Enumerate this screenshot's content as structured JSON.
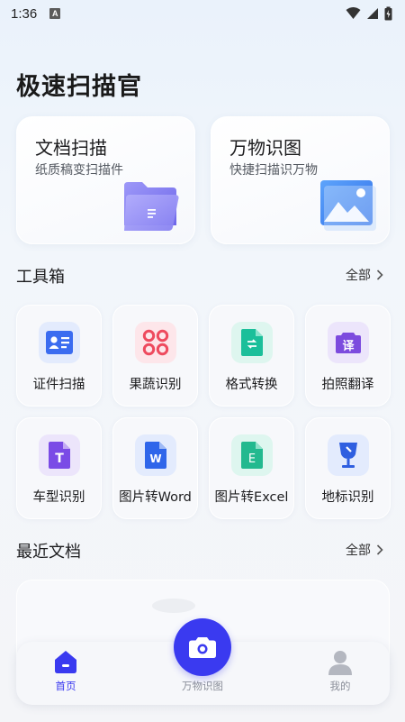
{
  "status_bar": {
    "time": "1:36",
    "notif_letter": "A"
  },
  "app_title": "极速扫描官",
  "cards": [
    {
      "title": "文档扫描",
      "subtitle": "纸质稿变扫描件",
      "icon": "folder-icon",
      "color": "#8b86f2"
    },
    {
      "title": "万物识图",
      "subtitle": "快捷扫描识万物",
      "icon": "image-icon",
      "color": "#3f8cf5"
    }
  ],
  "toolbox": {
    "title": "工具箱",
    "more_label": "全部",
    "items": [
      {
        "label": "证件扫描",
        "icon": "id-card-icon",
        "color": "#3b6cf0"
      },
      {
        "label": "果蔬识别",
        "icon": "fruit-dots-icon",
        "color": "#ee4a5e"
      },
      {
        "label": "格式转换",
        "icon": "file-convert-icon",
        "color": "#1bbf9a"
      },
      {
        "label": "拍照翻译",
        "icon": "camera-translate-icon",
        "color": "#7c4bde",
        "icon_text": "译"
      },
      {
        "label": "车型识别",
        "icon": "t-file-icon",
        "color": "#7a4be6",
        "icon_text": "T"
      },
      {
        "label": "图片转Word",
        "icon": "word-file-icon",
        "color": "#2f66ea",
        "icon_text": "W"
      },
      {
        "label": "图片转Excel",
        "icon": "excel-file-icon",
        "color": "#23b98f",
        "icon_text": "E"
      },
      {
        "label": "地标识别",
        "icon": "landmark-icon",
        "color": "#2f5fe0"
      }
    ]
  },
  "recent_docs": {
    "title": "最近文档",
    "more_label": "全部"
  },
  "tabbar": {
    "home_label": "首页",
    "scan_label": "万物识图",
    "mine_label": "我的",
    "active_color": "#3a3af0",
    "inactive_color": "#8a8e99"
  }
}
